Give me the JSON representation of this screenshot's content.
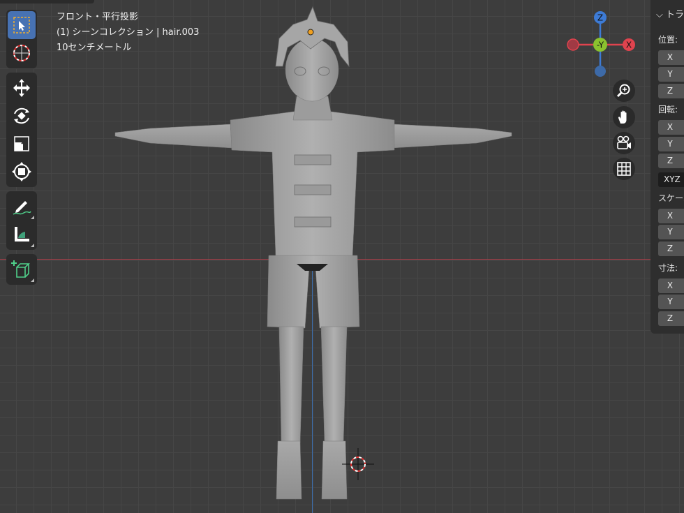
{
  "viewport": {
    "view_name": "フロント・平行投影",
    "collection_info": "(1) シーンコレクション | hair.003",
    "grid_scale": "10センチメートル"
  },
  "toolbar": {
    "tools": [
      {
        "name": "select-box",
        "icon": "select-box-icon",
        "active": true
      },
      {
        "name": "cursor",
        "icon": "cursor-icon"
      },
      {
        "name": "move",
        "icon": "move-icon"
      },
      {
        "name": "rotate",
        "icon": "rotate-icon"
      },
      {
        "name": "scale",
        "icon": "scale-icon"
      },
      {
        "name": "transform",
        "icon": "transform-icon"
      },
      {
        "name": "annotate",
        "icon": "annotate-icon"
      },
      {
        "name": "measure",
        "icon": "measure-icon"
      },
      {
        "name": "add-cube",
        "icon": "add-cube-icon"
      }
    ]
  },
  "gizmo": {
    "z": "Z",
    "y": "-Y",
    "x": "X"
  },
  "nav_buttons": [
    "zoom-icon",
    "hand-icon",
    "camera-icon",
    "grid-icon"
  ],
  "npanel": {
    "header": "トランスフォーム",
    "location_label": "位置:",
    "rotation_label": "回転:",
    "rotation_mode": "XYZ",
    "scale_label": "スケール:",
    "dimensions_label": "寸法:",
    "x": "X",
    "y": "Y",
    "z": "Z"
  },
  "colors": {
    "active_tool": "#4772b3",
    "axis_x": "#e0434e",
    "axis_y": "#8bc12f",
    "axis_z": "#3d7bd6",
    "origin": "#f0a020"
  }
}
